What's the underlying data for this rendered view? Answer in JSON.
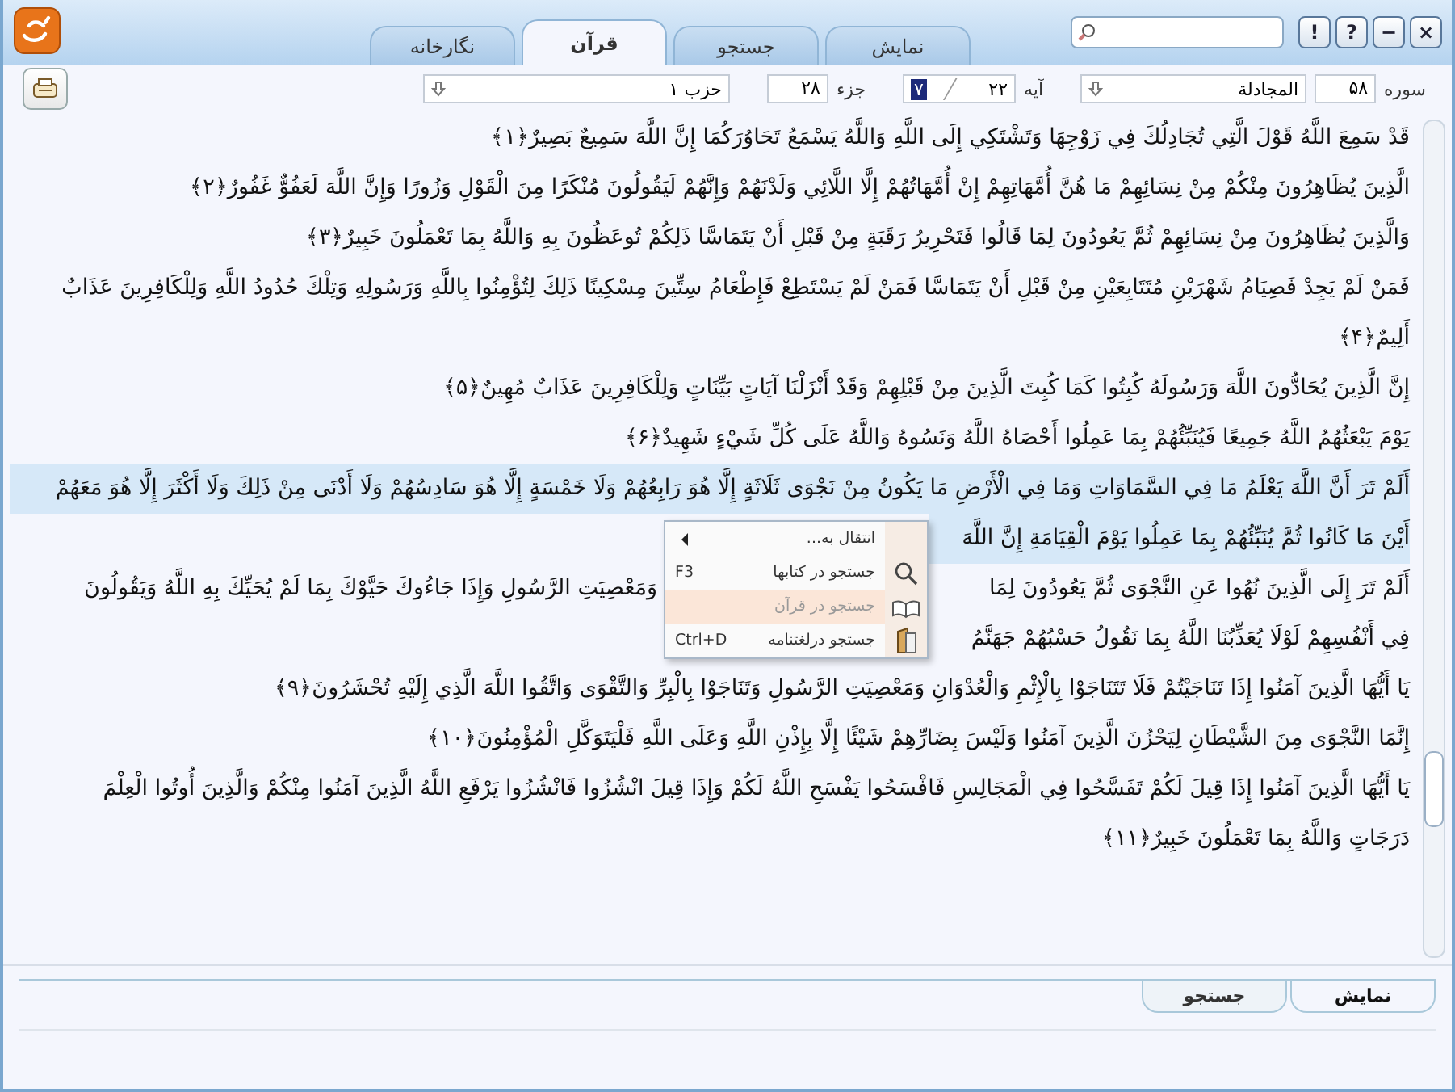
{
  "window_buttons": [
    "×",
    "−",
    "?",
    "!"
  ],
  "tabs": [
    {
      "label": "نمایش",
      "selected": false
    },
    {
      "label": "جستجو",
      "selected": false
    },
    {
      "label": "قرآن",
      "selected": true
    },
    {
      "label": "نگارخانه",
      "selected": false
    }
  ],
  "toolbar": {
    "surah_label": "سوره",
    "surah_number": "۵۸",
    "surah_name": "المجادلة",
    "ayah_label": "آیه",
    "ayah_total": "۲۲",
    "ayah_current": "۷",
    "juz_label": "جزء",
    "juz_value": "۲۸",
    "hizb_value": "حزب ۱"
  },
  "verses": [
    {
      "selected": false,
      "number": "﴿۱﴾",
      "lines": [
        {
          "kind": "full",
          "text": "قَدْ سَمِعَ اللَّهُ قَوْلَ الَّتِي تُجَادِلُكَ فِي زَوْجِهَا وَتَشْتَكِي إِلَى اللَّهِ وَاللَّهُ يَسْمَعُ تَحَاوُرَكُمَا إِنَّ اللَّهَ سَمِيعٌ بَصِيرٌ"
        }
      ]
    },
    {
      "selected": false,
      "number": "﴿۲﴾",
      "lines": [
        {
          "kind": "full",
          "text": "الَّذِينَ يُظَاهِرُونَ مِنْكُمْ مِنْ نِسَائِهِمْ مَا هُنَّ أُمَّهَاتِهِمْ إِنْ أُمَّهَاتُهُمْ إِلَّا اللَّائِي وَلَدْنَهُمْ وَإِنَّهُمْ لَيَقُولُونَ مُنْكَرًا مِنَ الْقَوْلِ وَزُورًا وَإِنَّ اللَّهَ لَعَفُوٌّ غَفُورٌ"
        }
      ]
    },
    {
      "selected": false,
      "number": "﴿۳﴾",
      "lines": [
        {
          "kind": "full",
          "text": "وَالَّذِينَ يُظَاهِرُونَ مِنْ نِسَائِهِمْ ثُمَّ يَعُودُونَ لِمَا قَالُوا فَتَحْرِيرُ رَقَبَةٍ مِنْ قَبْلِ أَنْ يَتَمَاسَّا ذَلِكُمْ تُوعَظُونَ بِهِ وَاللَّهُ بِمَا تَعْمَلُونَ خَبِيرٌ"
        }
      ]
    },
    {
      "selected": false,
      "number": "﴿۴﴾",
      "lines": [
        {
          "kind": "full",
          "text": "فَمَنْ لَمْ يَجِدْ فَصِيَامُ شَهْرَيْنِ مُتَتَابِعَيْنِ مِنْ قَبْلِ أَنْ يَتَمَاسَّا فَمَنْ لَمْ يَسْتَطِعْ فَإِطْعَامُ سِتِّينَ مِسْكِينًا ذَلِكَ لِتُؤْمِنُوا بِاللَّهِ وَرَسُولِهِ وَتِلْكَ حُدُودُ اللَّهِ وَلِلْكَافِرِينَ عَذَابٌ"
        },
        {
          "kind": "full",
          "text": "أَلِيمٌ"
        }
      ]
    },
    {
      "selected": false,
      "number": "﴿۵﴾",
      "lines": [
        {
          "kind": "full",
          "text": "إِنَّ الَّذِينَ يُحَادُّونَ اللَّهَ وَرَسُولَهُ كُبِتُوا كَمَا كُبِتَ الَّذِينَ مِنْ قَبْلِهِمْ وَقَدْ أَنْزَلْنَا آيَاتٍ بَيِّنَاتٍ وَلِلْكَافِرِينَ عَذَابٌ مُهِينٌ"
        }
      ]
    },
    {
      "selected": false,
      "number": "﴿۶﴾",
      "lines": [
        {
          "kind": "full",
          "text": "يَوْمَ يَبْعَثُهُمُ اللَّهُ جَمِيعًا فَيُنَبِّئُهُمْ بِمَا عَمِلُوا أَحْصَاهُ اللَّهُ وَنَسُوهُ وَاللَّهُ عَلَى كُلِّ شَيْءٍ شَهِيدٌ"
        }
      ]
    },
    {
      "selected": true,
      "lines": [
        {
          "kind": "full",
          "text": "أَلَمْ تَرَ أَنَّ اللَّهَ يَعْلَمُ مَا فِي السَّمَاوَاتِ وَمَا فِي الْأَرْضِ مَا يَكُونُ مِنْ نَجْوَى ثَلَاثَةٍ إِلَّا هُوَ رَابِعُهُمْ وَلَا خَمْسَةٍ إِلَّا هُوَ سَادِسُهُمْ وَلَا أَدْنَى مِنْ ذَلِكَ وَلَا أَكْثَرَ إِلَّا هُوَ مَعَهُمْ"
        },
        {
          "kind": "split",
          "text": "أَيْنَ مَا كَانُوا ثُمَّ يُنَبِّئُهُمْ بِمَا عَمِلُوا يَوْمَ الْقِيَامَةِ إِنَّ اللَّهَ"
        }
      ]
    },
    {
      "selected": false,
      "lines": [
        {
          "kind": "split",
          "text": "أَلَمْ تَرَ إِلَى الَّذِينَ نُهُوا عَنِ النَّجْوَى ثُمَّ يَعُودُونَ لِمَا",
          "text_beyond": "وَمَعْصِيَتِ الرَّسُولِ وَإِذَا جَاءُوكَ حَيَّوْكَ بِمَا لَمْ يُحَيِّكَ بِهِ اللَّهُ وَيَقُولُونَ"
        },
        {
          "kind": "split",
          "text": "فِي أَنْفُسِهِمْ لَوْلَا يُعَذِّبُنَا اللَّهُ بِمَا نَقُولُ حَسْبُهُمْ جَهَنَّمُ"
        }
      ]
    },
    {
      "selected": false,
      "number": "﴿۹﴾",
      "lines": [
        {
          "kind": "full",
          "text": "يَا أَيُّهَا الَّذِينَ آمَنُوا إِذَا تَنَاجَيْتُمْ فَلَا تَتَنَاجَوْا بِالْإِثْمِ وَالْعُدْوَانِ وَمَعْصِيَتِ الرَّسُولِ وَتَنَاجَوْا بِالْبِرِّ وَالتَّقْوَى وَاتَّقُوا اللَّهَ الَّذِي إِلَيْهِ تُحْشَرُونَ"
        }
      ]
    },
    {
      "selected": false,
      "number": "﴿۱۰﴾",
      "lines": [
        {
          "kind": "full",
          "text": "إِنَّمَا النَّجْوَى مِنَ الشَّيْطَانِ لِيَحْزُنَ الَّذِينَ آمَنُوا وَلَيْسَ بِضَارِّهِمْ شَيْئًا إِلَّا بِإِذْنِ اللَّهِ وَعَلَى اللَّهِ فَلْيَتَوَكَّلِ الْمُؤْمِنُونَ"
        }
      ]
    },
    {
      "selected": false,
      "number": "﴿۱۱﴾",
      "lines": [
        {
          "kind": "full",
          "text": "يَا أَيُّهَا الَّذِينَ آمَنُوا إِذَا قِيلَ لَكُمْ تَفَسَّحُوا فِي الْمَجَالِسِ فَافْسَحُوا يَفْسَحِ اللَّهُ لَكُمْ وَإِذَا قِيلَ انْشُزُوا فَانْشُزُوا يَرْفَعِ اللَّهُ الَّذِينَ آمَنُوا مِنْكُمْ وَالَّذِينَ أُوتُوا الْعِلْمَ"
        },
        {
          "kind": "full",
          "text": "دَرَجَاتٍ وَاللَّهُ بِمَا تَعْمَلُونَ خَبِيرٌ"
        }
      ]
    }
  ],
  "context_menu": [
    {
      "kind": "submenu",
      "label": "انتقال به...",
      "disabled": false,
      "highlighted": false
    },
    {
      "kind": "search",
      "label": "جستجو در کتابها",
      "shortcut": "F3",
      "disabled": false,
      "highlighted": false
    },
    {
      "kind": "book",
      "label": "جستجو در قرآن",
      "disabled": true,
      "highlighted": true
    },
    {
      "kind": "dictionary",
      "label": "جستجو درلغتنامه",
      "shortcut": "Ctrl+D",
      "disabled": false,
      "highlighted": false
    }
  ],
  "bottom_tabs": [
    {
      "label": "نمایش",
      "selected": true
    },
    {
      "label": "جستجو",
      "selected": false
    }
  ]
}
